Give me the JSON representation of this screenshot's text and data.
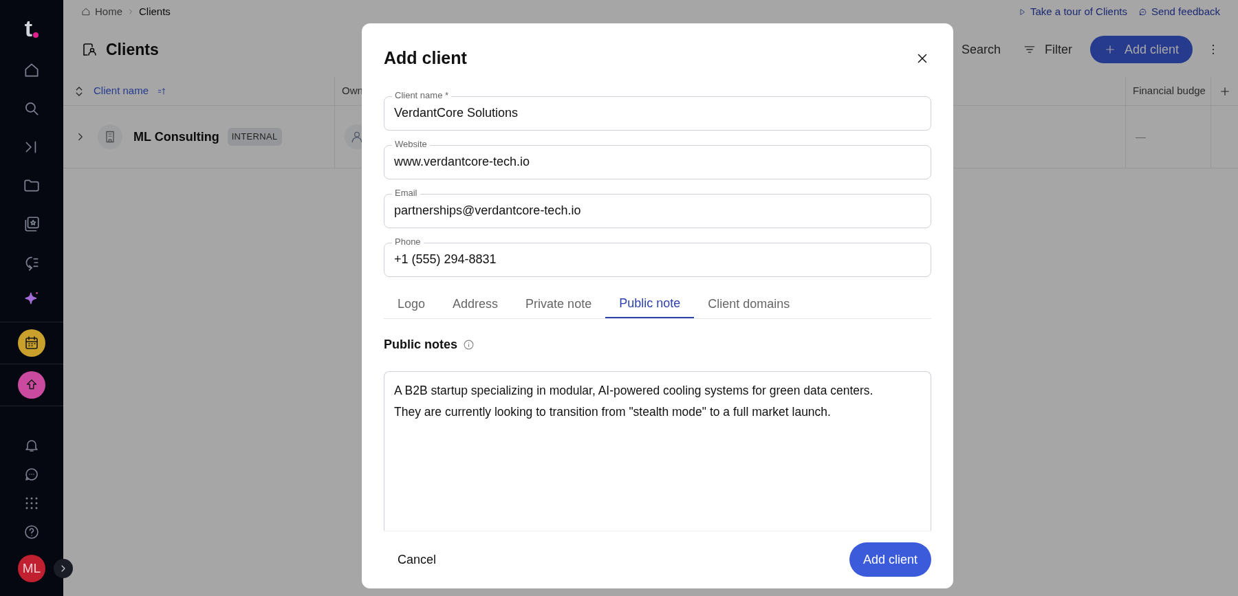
{
  "sidebar": {
    "logo": "t",
    "avatar": "ML"
  },
  "breadcrumb": [
    "Home",
    "Clients"
  ],
  "top_links": [
    "Take a tour of Clients",
    "Send feedback"
  ],
  "page_title": "Clients",
  "toolbar": {
    "search": "Search",
    "filter": "Filter",
    "add_button": "Add client"
  },
  "table": {
    "columns": [
      {
        "label": "Client name",
        "sorted": true
      },
      {
        "label": "Own",
        "sorted": false
      },
      {
        "label": "Financial budge",
        "sorted": false
      }
    ],
    "rows": [
      {
        "name": "ML Consulting",
        "tag": "INTERNAL",
        "budget": "—"
      }
    ]
  },
  "dialog": {
    "title": "Add client",
    "fields": [
      {
        "label": "Client name *",
        "value": "VerdantCore Solutions"
      },
      {
        "label": "Website",
        "value": "www.verdantcore-tech.io"
      },
      {
        "label": "Email",
        "value": "partnerships@verdantcore-tech.io"
      },
      {
        "label": "Phone",
        "value": "+1 (555) 294-8831"
      }
    ],
    "tabs": [
      {
        "label": "Logo",
        "selected": false
      },
      {
        "label": "Address",
        "selected": false
      },
      {
        "label": "Private note",
        "selected": false
      },
      {
        "label": "Public note",
        "selected": true
      },
      {
        "label": "Client domains",
        "selected": false
      }
    ],
    "notes_label": "Public notes",
    "notes_value": "A B2B startup specializing in modular, AI-powered cooling systems for green data centers.\nThey are currently looking to transition from \"stealth mode\" to a full market launch.",
    "cancel": "Cancel",
    "submit": "Add client"
  }
}
